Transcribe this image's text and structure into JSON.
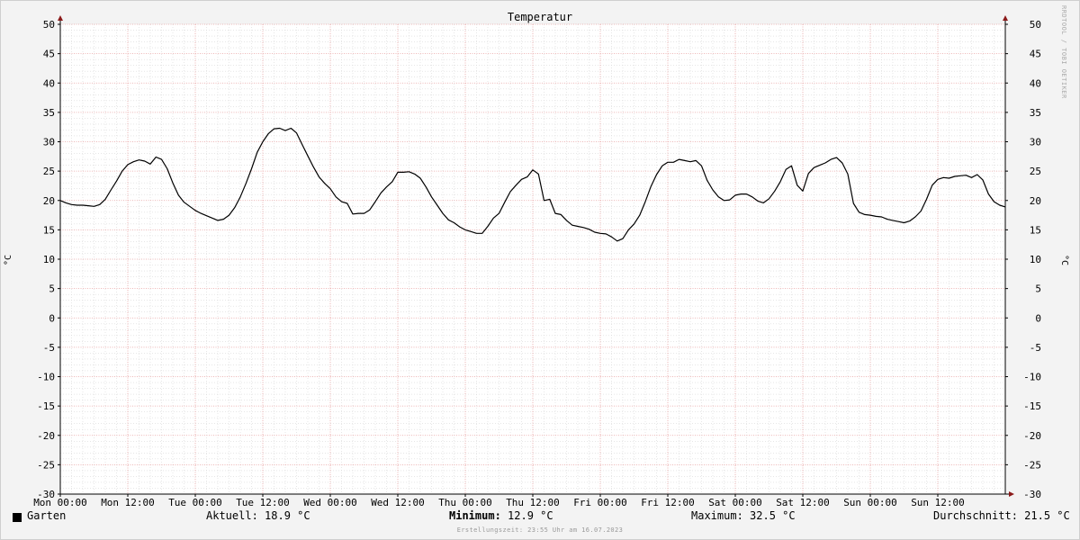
{
  "chart_data": {
    "type": "line",
    "title": "Temperatur",
    "ylabel": "°C",
    "ylim": [
      -30,
      50
    ],
    "ytick_step": 5,
    "x_ticks": [
      "Mon 00:00",
      "Mon 12:00",
      "Tue 00:00",
      "Tue 12:00",
      "Wed 00:00",
      "Wed 12:00",
      "Thu 00:00",
      "Thu 12:00",
      "Fri 00:00",
      "Fri 12:00",
      "Sat 00:00",
      "Sat 12:00",
      "Sun 00:00",
      "Sun 12:00"
    ],
    "x_range_hours": [
      0,
      168
    ],
    "grid": true,
    "series": [
      {
        "name": "Garten",
        "color": "#000000",
        "points": [
          [
            0,
            20
          ],
          [
            1,
            19.6
          ],
          [
            2,
            19.3
          ],
          [
            3,
            19.2
          ],
          [
            4,
            19.2
          ],
          [
            5,
            19.1
          ],
          [
            6,
            19.0
          ],
          [
            7,
            19.3
          ],
          [
            8,
            20.2
          ],
          [
            9,
            21.8
          ],
          [
            10,
            23.3
          ],
          [
            11,
            25.0
          ],
          [
            12,
            26.1
          ],
          [
            13,
            26.6
          ],
          [
            14,
            26.9
          ],
          [
            15,
            26.7
          ],
          [
            16,
            26.2
          ],
          [
            17,
            27.4
          ],
          [
            18,
            27.0
          ],
          [
            19,
            25.4
          ],
          [
            20,
            23.0
          ],
          [
            21,
            20.9
          ],
          [
            22,
            19.7
          ],
          [
            23,
            19.0
          ],
          [
            24,
            18.3
          ],
          [
            25,
            17.8
          ],
          [
            26,
            17.4
          ],
          [
            27,
            17.0
          ],
          [
            28,
            16.6
          ],
          [
            29,
            16.8
          ],
          [
            30,
            17.5
          ],
          [
            31,
            18.8
          ],
          [
            32,
            20.6
          ],
          [
            33,
            22.9
          ],
          [
            34,
            25.4
          ],
          [
            35,
            28.2
          ],
          [
            36,
            30.0
          ],
          [
            37,
            31.4
          ],
          [
            38,
            32.2
          ],
          [
            39,
            32.3
          ],
          [
            40,
            31.9
          ],
          [
            41,
            32.3
          ],
          [
            42,
            31.5
          ],
          [
            43,
            29.5
          ],
          [
            44,
            27.6
          ],
          [
            45,
            25.7
          ],
          [
            46,
            24.0
          ],
          [
            47,
            22.9
          ],
          [
            48,
            22.0
          ],
          [
            49,
            20.6
          ],
          [
            50,
            19.8
          ],
          [
            51,
            19.5
          ],
          [
            52,
            17.7
          ],
          [
            53,
            17.8
          ],
          [
            54,
            17.8
          ],
          [
            55,
            18.4
          ],
          [
            56,
            19.8
          ],
          [
            57,
            21.3
          ],
          [
            58,
            22.3
          ],
          [
            59,
            23.2
          ],
          [
            60,
            24.8
          ],
          [
            61,
            24.8
          ],
          [
            62,
            24.9
          ],
          [
            63,
            24.5
          ],
          [
            64,
            23.8
          ],
          [
            65,
            22.3
          ],
          [
            66,
            20.6
          ],
          [
            67,
            19.2
          ],
          [
            68,
            17.8
          ],
          [
            69,
            16.7
          ],
          [
            70,
            16.2
          ],
          [
            71,
            15.5
          ],
          [
            72,
            15.0
          ],
          [
            73,
            14.7
          ],
          [
            74,
            14.4
          ],
          [
            75,
            14.4
          ],
          [
            76,
            15.6
          ],
          [
            77,
            17.0
          ],
          [
            78,
            17.8
          ],
          [
            79,
            19.7
          ],
          [
            80,
            21.5
          ],
          [
            81,
            22.6
          ],
          [
            82,
            23.6
          ],
          [
            83,
            24.0
          ],
          [
            84,
            25.2
          ],
          [
            85,
            24.5
          ],
          [
            86,
            20.0
          ],
          [
            87,
            20.2
          ],
          [
            88,
            17.8
          ],
          [
            89,
            17.6
          ],
          [
            90,
            16.6
          ],
          [
            91,
            15.8
          ],
          [
            92,
            15.6
          ],
          [
            93,
            15.4
          ],
          [
            94,
            15.1
          ],
          [
            95,
            14.6
          ],
          [
            96,
            14.4
          ],
          [
            97,
            14.3
          ],
          [
            98,
            13.8
          ],
          [
            99,
            13.1
          ],
          [
            100,
            13.5
          ],
          [
            101,
            15.0
          ],
          [
            102,
            16.0
          ],
          [
            103,
            17.5
          ],
          [
            104,
            19.8
          ],
          [
            105,
            22.4
          ],
          [
            106,
            24.4
          ],
          [
            107,
            25.9
          ],
          [
            108,
            26.5
          ],
          [
            109,
            26.5
          ],
          [
            110,
            27.0
          ],
          [
            111,
            26.8
          ],
          [
            112,
            26.6
          ],
          [
            113,
            26.8
          ],
          [
            114,
            25.9
          ],
          [
            115,
            23.4
          ],
          [
            116,
            21.8
          ],
          [
            117,
            20.6
          ],
          [
            118,
            20.0
          ],
          [
            119,
            20.1
          ],
          [
            120,
            20.9
          ],
          [
            121,
            21.1
          ],
          [
            122,
            21.1
          ],
          [
            123,
            20.6
          ],
          [
            124,
            19.9
          ],
          [
            125,
            19.6
          ],
          [
            126,
            20.3
          ],
          [
            127,
            21.6
          ],
          [
            128,
            23.2
          ],
          [
            129,
            25.3
          ],
          [
            130,
            25.9
          ],
          [
            131,
            22.6
          ],
          [
            132,
            21.6
          ],
          [
            133,
            24.6
          ],
          [
            134,
            25.6
          ],
          [
            135,
            26.0
          ],
          [
            136,
            26.4
          ],
          [
            137,
            27.0
          ],
          [
            138,
            27.3
          ],
          [
            139,
            26.4
          ],
          [
            140,
            24.5
          ],
          [
            141,
            19.5
          ],
          [
            142,
            18.0
          ],
          [
            143,
            17.6
          ],
          [
            144,
            17.5
          ],
          [
            145,
            17.3
          ],
          [
            146,
            17.2
          ],
          [
            147,
            16.8
          ],
          [
            148,
            16.6
          ],
          [
            149,
            16.4
          ],
          [
            150,
            16.2
          ],
          [
            151,
            16.5
          ],
          [
            152,
            17.2
          ],
          [
            153,
            18.2
          ],
          [
            154,
            20.2
          ],
          [
            155,
            22.6
          ],
          [
            156,
            23.6
          ],
          [
            157,
            23.9
          ],
          [
            158,
            23.8
          ],
          [
            159,
            24.1
          ],
          [
            160,
            24.2
          ],
          [
            161,
            24.3
          ],
          [
            162,
            23.9
          ],
          [
            163,
            24.4
          ],
          [
            164,
            23.5
          ],
          [
            165,
            21.1
          ],
          [
            166,
            19.8
          ],
          [
            167,
            19.2
          ],
          [
            168,
            18.9
          ]
        ]
      }
    ]
  },
  "legend": {
    "series_name": "Garten",
    "current_label": "Aktuell:",
    "current_value": "18.9 °C",
    "min_label": "Minimum:",
    "min_value": "12.9 °C",
    "max_label": "Maximum:",
    "max_value": "32.5 °C",
    "avg_label": "Durchschnitt:",
    "avg_value": "21.5 °C"
  },
  "footer": "Erstellungszeit: 23:55 Uhr am 16.07.2023",
  "watermark": "RRDTOOL / TOBI OETIKER",
  "colors": {
    "background": "#f3f3f3",
    "plot_background": "#ffffff",
    "major_grid": "#e8a0a0",
    "minor_grid": "#d8d8d8",
    "axis_arrow": "#8b1a1a",
    "line": "#000000"
  }
}
